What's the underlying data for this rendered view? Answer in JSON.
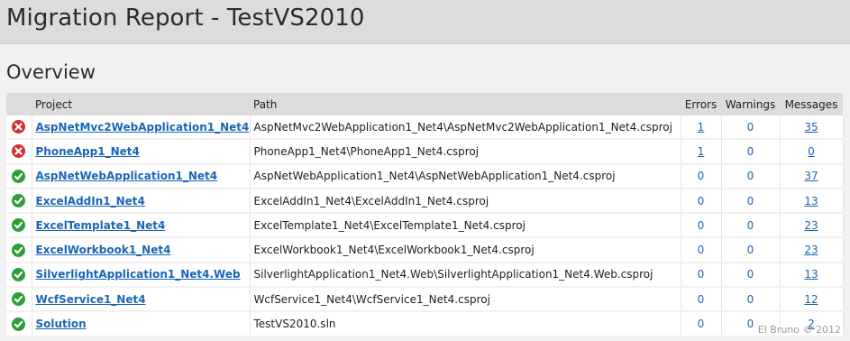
{
  "header": {
    "title": "Migration Report - TestVS2010"
  },
  "overview": {
    "title": "Overview"
  },
  "columns": {
    "project": "Project",
    "path": "Path",
    "errors": "Errors",
    "warnings": "Warnings",
    "messages": "Messages"
  },
  "rows": [
    {
      "status": "error",
      "project": "AspNetMvc2WebApplication1_Net4",
      "path": "AspNetMvc2WebApplication1_Net4\\AspNetMvc2WebApplication1_Net4.csproj",
      "errors": "1",
      "warnings": "0",
      "messages": "35"
    },
    {
      "status": "error",
      "project": "PhoneApp1_Net4",
      "path": "PhoneApp1_Net4\\PhoneApp1_Net4.csproj",
      "errors": "1",
      "warnings": "0",
      "messages": "0"
    },
    {
      "status": "ok",
      "project": "AspNetWebApplication1_Net4",
      "path": "AspNetWebApplication1_Net4\\AspNetWebApplication1_Net4.csproj",
      "errors": "0",
      "warnings": "0",
      "messages": "37"
    },
    {
      "status": "ok",
      "project": "ExcelAddIn1_Net4",
      "path": "ExcelAddIn1_Net4\\ExcelAddIn1_Net4.csproj",
      "errors": "0",
      "warnings": "0",
      "messages": "13"
    },
    {
      "status": "ok",
      "project": "ExcelTemplate1_Net4",
      "path": "ExcelTemplate1_Net4\\ExcelTemplate1_Net4.csproj",
      "errors": "0",
      "warnings": "0",
      "messages": "23"
    },
    {
      "status": "ok",
      "project": "ExcelWorkbook1_Net4",
      "path": "ExcelWorkbook1_Net4\\ExcelWorkbook1_Net4.csproj",
      "errors": "0",
      "warnings": "0",
      "messages": "23"
    },
    {
      "status": "ok",
      "project": "SilverlightApplication1_Net4.Web",
      "path": "SilverlightApplication1_Net4.Web\\SilverlightApplication1_Net4.Web.csproj",
      "errors": "0",
      "warnings": "0",
      "messages": "13"
    },
    {
      "status": "ok",
      "project": "WcfService1_Net4",
      "path": "WcfService1_Net4\\WcfService1_Net4.csproj",
      "errors": "0",
      "warnings": "0",
      "messages": "12"
    },
    {
      "status": "ok",
      "project": "Solution",
      "path": "TestVS2010.sln",
      "errors": "0",
      "warnings": "0",
      "messages": "2"
    }
  ],
  "colors": {
    "error": "#d32f2f",
    "ok": "#2e9e3a",
    "link": "#1a66b5"
  },
  "watermark": "El Bruno © 2012"
}
